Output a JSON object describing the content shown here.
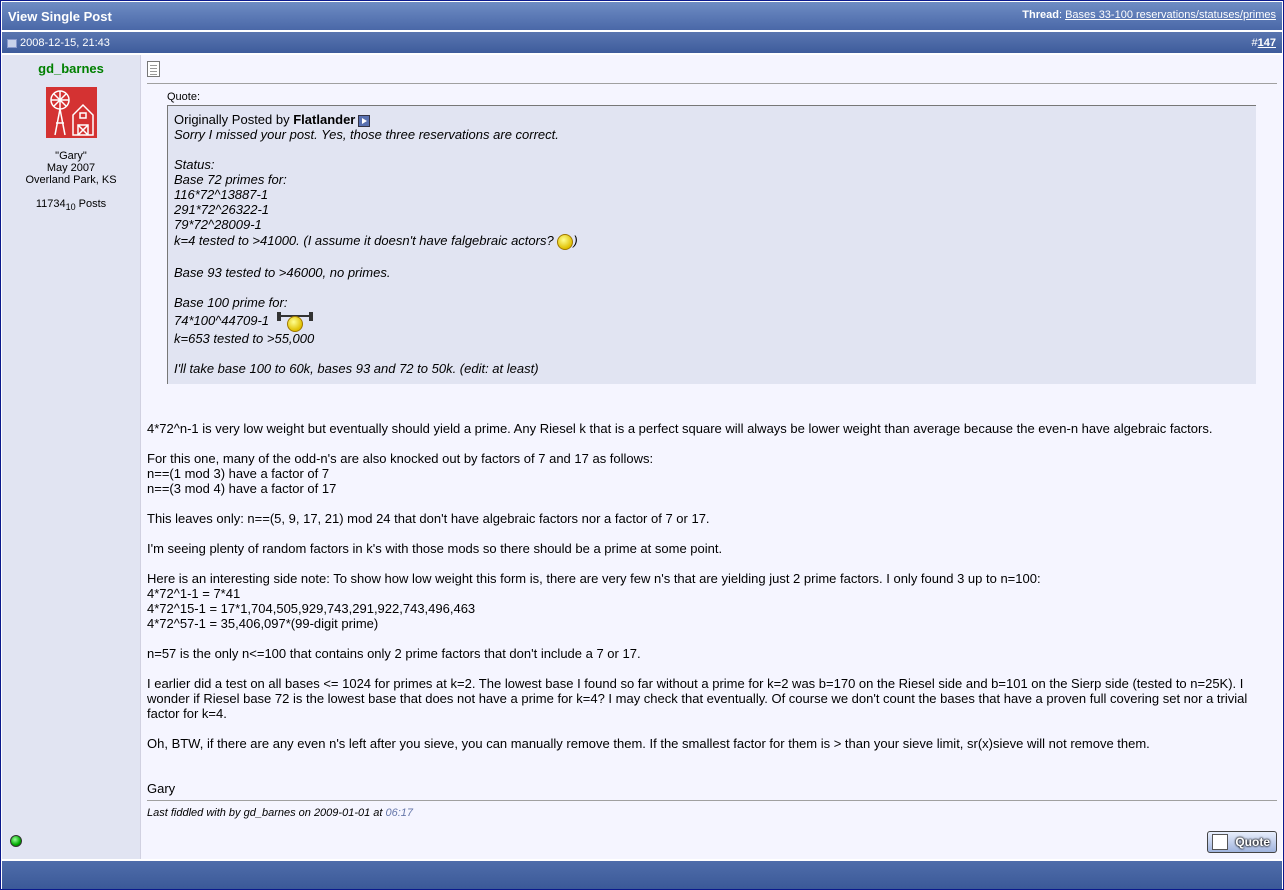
{
  "header": {
    "title": "View Single Post",
    "thread_label": "Thread",
    "thread_link": "Bases 33-100 reservations/statuses/primes"
  },
  "post_header": {
    "date": "2008-12-15, 21:43",
    "number_prefix": "#",
    "number": "147"
  },
  "user": {
    "name": "gd_barnes",
    "name_color": "#008000",
    "real_name": "\"Gary\"",
    "joined": "May 2007",
    "location": "Overland Park, KS",
    "posts_value": "11734",
    "posts_sub": "10",
    "posts_label": " Posts",
    "online_icon": "online-status-icon"
  },
  "quote": {
    "label": "Quote:",
    "originally_posted_by": "Originally Posted by ",
    "author": "Flatlander",
    "lines": [
      "Sorry I missed your post. Yes, those three reservations are correct.",
      "",
      "Status:",
      "Base 72 primes for:",
      "116*72^13887-1",
      "291*72^26322-1",
      "79*72^28009-1",
      "k=4 tested to >41000. (I assume it doesn't have falgebraic actors? ",
      "",
      "Base 93 tested to >46000, no primes.",
      "",
      "Base 100 prime for:",
      "74*100^44709-1 ",
      "k=653 tested to >55,000",
      "",
      "I'll take base 100 to 60k, bases 93 and 72 to 50k. (edit: at least)"
    ],
    "close_paren": ")"
  },
  "body": {
    "lines": [
      "4*72^n-1 is very low weight but eventually should yield a prime. Any Riesel k that is a perfect square will always be lower weight than average because the even-n have algebraic factors.",
      "",
      "For this one, many of the odd-n's are also knocked out by factors of 7 and 17 as follows:",
      "n==(1 mod 3) have a factor of 7",
      "n==(3 mod 4) have a factor of 17",
      "",
      "This leaves only: n==(5, 9, 17, 21) mod 24 that don't have algebraic factors nor a factor of 7 or 17.",
      "",
      "I'm seeing plenty of random factors in k's with those mods so there should be a prime at some point.",
      "",
      "Here is an interesting side note: To show how low weight this form is, there are very few n's that are yielding just 2 prime factors. I only found 3 up to n=100:",
      "4*72^1-1 = 7*41",
      "4*72^15-1 = 17*1,704,505,929,743,291,922,743,496,463",
      "4*72^57-1 = 35,406,097*(99-digit prime)",
      "",
      "n=57 is the only n<=100 that contains only 2 prime factors that don't include a 7 or 17.",
      "",
      "I earlier did a test on all bases <= 1024 for primes at k=2. The lowest base I found so far without a prime for k=2 was b=170 on the Riesel side and b=101 on the Sierp side (tested to n=25K). I wonder if Riesel base 72 is the lowest base that does not have a prime for k=4? I may check that eventually. Of course we don't count the bases that have a proven full covering set nor a trivial factor for k=4.",
      "",
      "Oh, BTW, if there are any even n's left after you sieve, you can manually remove them. If the smallest factor for them is > than your sieve limit, sr(x)sieve will not remove them."
    ],
    "signature": "Gary",
    "edited_prefix": "Last fiddled with by gd_barnes on 2009-01-01 at ",
    "edited_time": "06:17"
  },
  "buttons": {
    "quote": "Quote"
  },
  "colors": {
    "header_bg": "#5c79b5",
    "userpane_bg": "#e1e4f2",
    "content_bg": "#f5f5ff",
    "quote_bg": "#e1e4f2"
  }
}
